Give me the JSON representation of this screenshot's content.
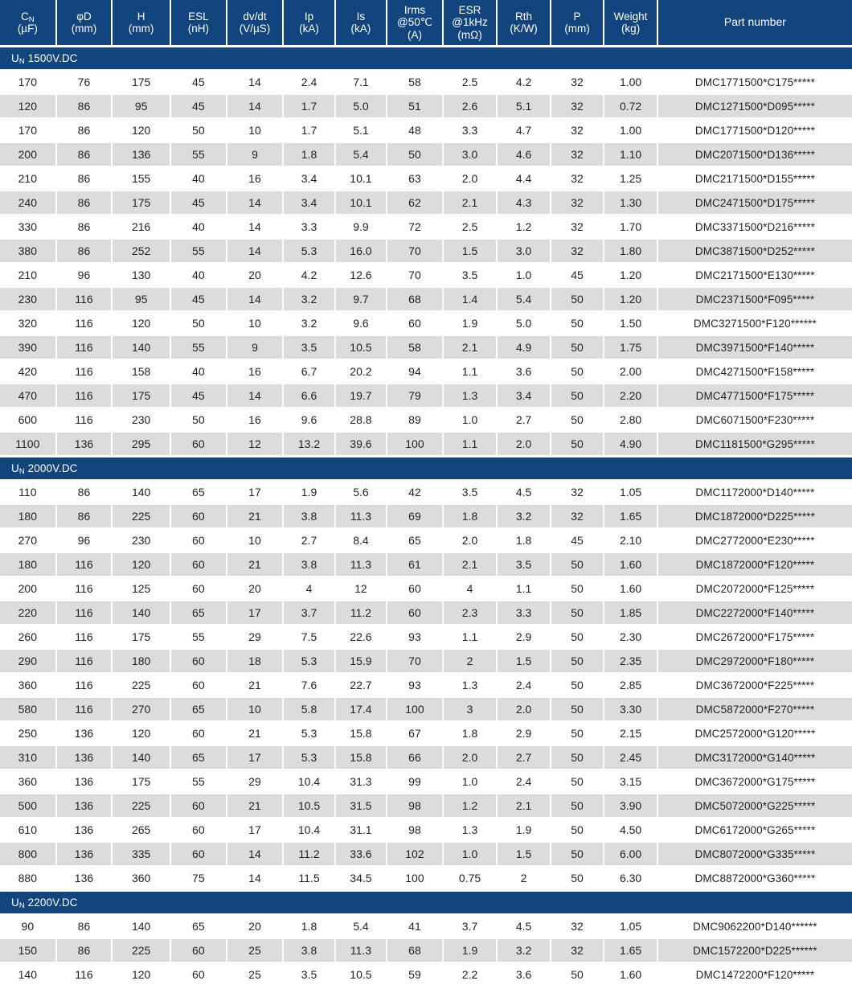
{
  "table": {
    "columns": [
      {
        "id": "cn",
        "l1": "C",
        "sub": "N",
        "l2": "(µF)",
        "l3": ""
      },
      {
        "id": "phid",
        "l1": "φD",
        "sub": "",
        "l2": "(mm)",
        "l3": ""
      },
      {
        "id": "h",
        "l1": "H",
        "sub": "",
        "l2": "(mm)",
        "l3": ""
      },
      {
        "id": "esl",
        "l1": "ESL",
        "sub": "",
        "l2": "(nH)",
        "l3": ""
      },
      {
        "id": "dvdt",
        "l1": "dv/dt",
        "sub": "",
        "l2": "(V/µS)",
        "l3": ""
      },
      {
        "id": "ip",
        "l1": "Ip",
        "sub": "",
        "l2": "(kA)",
        "l3": ""
      },
      {
        "id": "is",
        "l1": "Is",
        "sub": "",
        "l2": "(kA)",
        "l3": ""
      },
      {
        "id": "irms",
        "l1": "Irms",
        "sub": "",
        "l2": "@50℃",
        "l3": "(A)"
      },
      {
        "id": "esr",
        "l1": "ESR",
        "sub": "",
        "l2": "@1kHz",
        "l3": "(mΩ)"
      },
      {
        "id": "rth",
        "l1": "Rth",
        "sub": "",
        "l2": "(K/W)",
        "l3": ""
      },
      {
        "id": "p",
        "l1": "P",
        "sub": "",
        "l2": "(mm)",
        "l3": ""
      },
      {
        "id": "weight",
        "l1": "Weight",
        "sub": "",
        "l2": "(kg)",
        "l3": ""
      },
      {
        "id": "part",
        "l1": "Part number",
        "sub": "",
        "l2": "",
        "l3": ""
      }
    ],
    "sections": [
      {
        "label_prefix": "U",
        "label_sub": "N",
        "label_suffix": " 1500V.DC",
        "rows": [
          [
            "170",
            "76",
            "175",
            "45",
            "14",
            "2.4",
            "7.1",
            "58",
            "2.5",
            "4.2",
            "32",
            "1.00",
            "DMC1771500*C175*****"
          ],
          [
            "120",
            "86",
            "95",
            "45",
            "14",
            "1.7",
            "5.0",
            "51",
            "2.6",
            "5.1",
            "32",
            "0.72",
            "DMC1271500*D095*****"
          ],
          [
            "170",
            "86",
            "120",
            "50",
            "10",
            "1.7",
            "5.1",
            "48",
            "3.3",
            "4.7",
            "32",
            "1.00",
            "DMC1771500*D120*****"
          ],
          [
            "200",
            "86",
            "136",
            "55",
            "9",
            "1.8",
            "5.4",
            "50",
            "3.0",
            "4.6",
            "32",
            "1.10",
            "DMC2071500*D136*****"
          ],
          [
            "210",
            "86",
            "155",
            "40",
            "16",
            "3.4",
            "10.1",
            "63",
            "2.0",
            "4.4",
            "32",
            "1.25",
            "DMC2171500*D155*****"
          ],
          [
            "240",
            "86",
            "175",
            "45",
            "14",
            "3.4",
            "10.1",
            "62",
            "2.1",
            "4.3",
            "32",
            "1.30",
            "DMC2471500*D175*****"
          ],
          [
            "330",
            "86",
            "216",
            "40",
            "14",
            "3.3",
            "9.9",
            "72",
            "2.5",
            "1.2",
            "32",
            "1.70",
            "DMC3371500*D216*****"
          ],
          [
            "380",
            "86",
            "252",
            "55",
            "14",
            "5.3",
            "16.0",
            "70",
            "1.5",
            "3.0",
            "32",
            "1.80",
            "DMC3871500*D252*****"
          ],
          [
            "210",
            "96",
            "130",
            "40",
            "20",
            "4.2",
            "12.6",
            "70",
            "3.5",
            "1.0",
            "45",
            "1.20",
            "DMC2171500*E130*****"
          ],
          [
            "230",
            "116",
            "95",
            "45",
            "14",
            "3.2",
            "9.7",
            "68",
            "1.4",
            "5.4",
            "50",
            "1.20",
            "DMC2371500*F095*****"
          ],
          [
            "320",
            "116",
            "120",
            "50",
            "10",
            "3.2",
            "9.6",
            "60",
            "1.9",
            "5.0",
            "50",
            "1.50",
            "DMC3271500*F120******"
          ],
          [
            "390",
            "116",
            "140",
            "55",
            "9",
            "3.5",
            "10.5",
            "58",
            "2.1",
            "4.9",
            "50",
            "1.75",
            "DMC3971500*F140*****"
          ],
          [
            "420",
            "116",
            "158",
            "40",
            "16",
            "6.7",
            "20.2",
            "94",
            "1.1",
            "3.6",
            "50",
            "2.00",
            "DMC4271500*F158*****"
          ],
          [
            "470",
            "116",
            "175",
            "45",
            "14",
            "6.6",
            "19.7",
            "79",
            "1.3",
            "3.4",
            "50",
            "2.20",
            "DMC4771500*F175*****"
          ],
          [
            "600",
            "116",
            "230",
            "50",
            "16",
            "9.6",
            "28.8",
            "89",
            "1.0",
            "2.7",
            "50",
            "2.80",
            "DMC6071500*F230*****"
          ],
          [
            "1100",
            "136",
            "295",
            "60",
            "12",
            "13.2",
            "39.6",
            "100",
            "1.1",
            "2.0",
            "50",
            "4.90",
            "DMC1181500*G295*****"
          ]
        ]
      },
      {
        "label_prefix": "U",
        "label_sub": "N",
        "label_suffix": " 2000V.DC",
        "rows": [
          [
            "110",
            "86",
            "140",
            "65",
            "17",
            "1.9",
            "5.6",
            "42",
            "3.5",
            "4.5",
            "32",
            "1.05",
            "DMC1172000*D140*****"
          ],
          [
            "180",
            "86",
            "225",
            "60",
            "21",
            "3.8",
            "11.3",
            "69",
            "1.8",
            "3.2",
            "32",
            "1.65",
            "DMC1872000*D225*****"
          ],
          [
            "270",
            "96",
            "230",
            "60",
            "10",
            "2.7",
            "8.4",
            "65",
            "2.0",
            "1.8",
            "45",
            "2.10",
            "DMC2772000*E230*****"
          ],
          [
            "180",
            "116",
            "120",
            "60",
            "21",
            "3.8",
            "11.3",
            "61",
            "2.1",
            "3.5",
            "50",
            "1.60",
            "DMC1872000*F120*****"
          ],
          [
            "200",
            "116",
            "125",
            "60",
            "20",
            "4",
            "12",
            "60",
            "4",
            "1.1",
            "50",
            "1.60",
            "DMC2072000*F125*****"
          ],
          [
            "220",
            "116",
            "140",
            "65",
            "17",
            "3.7",
            "11.2",
            "60",
            "2.3",
            "3.3",
            "50",
            "1.85",
            "DMC2272000*F140*****"
          ],
          [
            "260",
            "116",
            "175",
            "55",
            "29",
            "7.5",
            "22.6",
            "93",
            "1.1",
            "2.9",
            "50",
            "2.30",
            "DMC2672000*F175*****"
          ],
          [
            "290",
            "116",
            "180",
            "60",
            "18",
            "5.3",
            "15.9",
            "70",
            "2",
            "1.5",
            "50",
            "2.35",
            "DMC2972000*F180*****"
          ],
          [
            "360",
            "116",
            "225",
            "60",
            "21",
            "7.6",
            "22.7",
            "93",
            "1.3",
            "2.4",
            "50",
            "2.85",
            "DMC3672000*F225*****"
          ],
          [
            "580",
            "116",
            "270",
            "65",
            "10",
            "5.8",
            "17.4",
            "100",
            "3",
            "2.0",
            "50",
            "3.30",
            "DMC5872000*F270*****"
          ],
          [
            "250",
            "136",
            "120",
            "60",
            "21",
            "5.3",
            "15.8",
            "67",
            "1.8",
            "2.9",
            "50",
            "2.15",
            "DMC2572000*G120*****"
          ],
          [
            "310",
            "136",
            "140",
            "65",
            "17",
            "5.3",
            "15.8",
            "66",
            "2.0",
            "2.7",
            "50",
            "2.45",
            "DMC3172000*G140*****"
          ],
          [
            "360",
            "136",
            "175",
            "55",
            "29",
            "10.4",
            "31.3",
            "99",
            "1.0",
            "2.4",
            "50",
            "3.15",
            "DMC3672000*G175*****"
          ],
          [
            "500",
            "136",
            "225",
            "60",
            "21",
            "10.5",
            "31.5",
            "98",
            "1.2",
            "2.1",
            "50",
            "3.90",
            "DMC5072000*G225*****"
          ],
          [
            "610",
            "136",
            "265",
            "60",
            "17",
            "10.4",
            "31.1",
            "98",
            "1.3",
            "1.9",
            "50",
            "4.50",
            "DMC6172000*G265*****"
          ],
          [
            "800",
            "136",
            "335",
            "60",
            "14",
            "11.2",
            "33.6",
            "102",
            "1.0",
            "1.5",
            "50",
            "6.00",
            "DMC8072000*G335*****"
          ],
          [
            "880",
            "136",
            "360",
            "75",
            "14",
            "11.5",
            "34.5",
            "100",
            "0.75",
            "2",
            "50",
            "6.30",
            "DMC8872000*G360*****"
          ]
        ]
      },
      {
        "label_prefix": "U",
        "label_sub": "N",
        "label_suffix": " 2200V.DC",
        "rows": [
          [
            "90",
            "86",
            "140",
            "65",
            "20",
            "1.8",
            "5.4",
            "41",
            "3.7",
            "4.5",
            "32",
            "1.05",
            "DMC9062200*D140******"
          ],
          [
            "150",
            "86",
            "225",
            "60",
            "25",
            "3.8",
            "11.3",
            "68",
            "1.9",
            "3.2",
            "32",
            "1.65",
            "DMC1572200*D225******"
          ],
          [
            "140",
            "116",
            "120",
            "60",
            "25",
            "3.5",
            "10.5",
            "59",
            "2.2",
            "3.6",
            "50",
            "1.60",
            "DMC1472200*F120*****"
          ]
        ]
      }
    ],
    "colors": {
      "header_blue": "#12447e",
      "row_grey": "#dcdcdc",
      "row_white": "#ffffff",
      "text": "#231f20"
    }
  }
}
